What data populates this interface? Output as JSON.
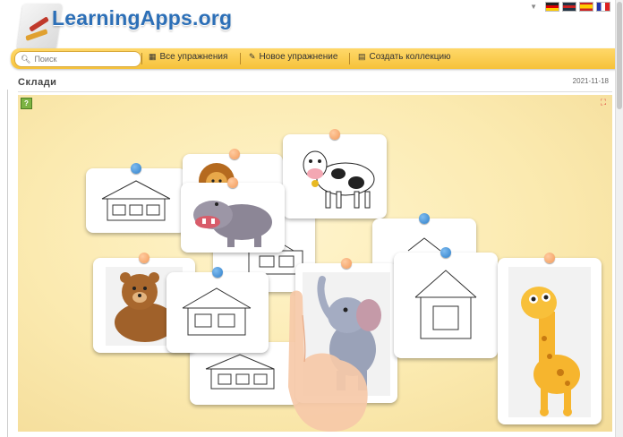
{
  "header": {
    "logo_text": "LearningApps.org",
    "languages": [
      "de",
      "en",
      "es",
      "fr"
    ]
  },
  "nav": {
    "search_placeholder": "Поиск",
    "items": [
      {
        "label": "Все упражнения",
        "icon": "grid-icon"
      },
      {
        "label": "Новое упражнение",
        "icon": "pencil-icon"
      },
      {
        "label": "Создать коллекцию",
        "icon": "collection-icon"
      }
    ]
  },
  "page": {
    "title": "Склади",
    "date": "2021-11-18"
  },
  "cards": [
    {
      "name": "house-3-rooms-card",
      "pin": "blue",
      "content": "house-3-rooms"
    },
    {
      "name": "lion-card",
      "pin": "orange",
      "content": "lion"
    },
    {
      "name": "cow-card",
      "pin": "orange",
      "content": "cow"
    },
    {
      "name": "hippo-card",
      "pin": "orange",
      "content": "hippo"
    },
    {
      "name": "house-under-card",
      "pin": "blue",
      "content": "house-2-rooms"
    },
    {
      "name": "house-roof-card",
      "pin": "blue",
      "content": "house-roof"
    },
    {
      "name": "bear-card",
      "pin": "orange",
      "content": "bear"
    },
    {
      "name": "house-2-rooms-card",
      "pin": "blue",
      "content": "house-2-rooms"
    },
    {
      "name": "elephant-card",
      "pin": "orange",
      "content": "elephant"
    },
    {
      "name": "house-1-room-card",
      "pin": "blue",
      "content": "house-1-room"
    },
    {
      "name": "giraffe-card",
      "pin": "orange",
      "content": "giraffe"
    },
    {
      "name": "house-bottom-card",
      "pin": "blue",
      "content": "house-3-rooms"
    }
  ],
  "colors": {
    "accent_yellow": "#f6c23a",
    "logo_blue": "#2c6fb7",
    "pin_blue": "#2f7fc9",
    "pin_orange": "#f29a5a",
    "board_bg": "#fbeab0"
  }
}
